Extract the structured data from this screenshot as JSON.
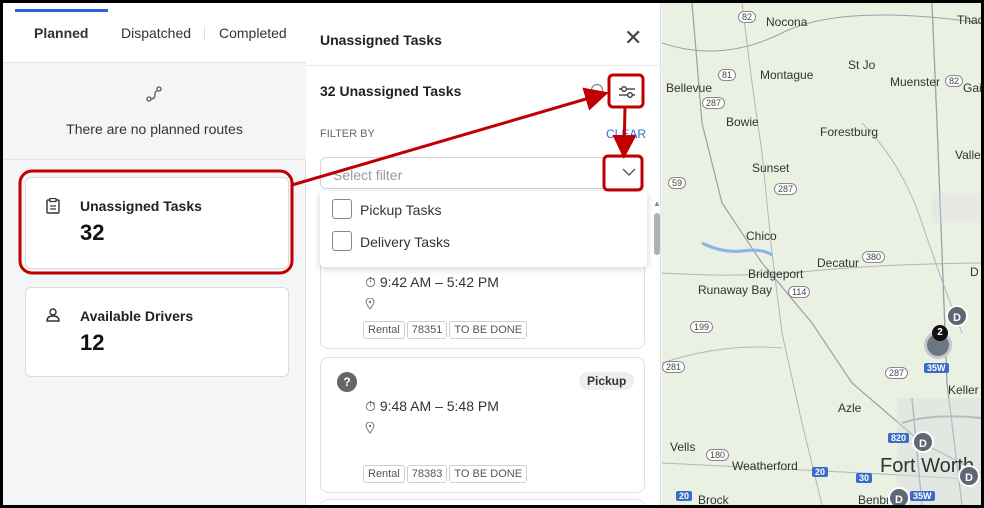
{
  "tabs": {
    "planned": "Planned",
    "dispatched": "Dispatched",
    "completed": "Completed"
  },
  "empty_state": {
    "icon": "route-icon",
    "text": "There are no planned routes"
  },
  "stats": {
    "unassigned": {
      "icon": "clipboard-icon",
      "label": "Unassigned Tasks",
      "value": "32"
    },
    "drivers": {
      "icon": "person-icon",
      "label": "Available Drivers",
      "value": "12"
    }
  },
  "panel": {
    "title": "Unassigned Tasks",
    "close_icon": "close-icon",
    "count_title": "32 Unassigned Tasks",
    "filter_by": "FILTER BY",
    "clear": "CLEAR",
    "select_placeholder": "Select filter",
    "options": [
      "Pickup Tasks",
      "Delivery Tasks"
    ]
  },
  "tasks": [
    {
      "time": "9:42 AM – 5:42 PM",
      "tags": [
        "Rental",
        "78351",
        "TO BE DONE"
      ]
    },
    {
      "badge": "?",
      "type": "Pickup",
      "time": "9:48 AM – 5:48 PM",
      "tags": [
        "Rental",
        "78383",
        "TO BE DONE"
      ]
    }
  ],
  "map": {
    "places": [
      "Nocona",
      "Thac",
      "Montague",
      "St Jo",
      "Muenster",
      "Gai",
      "Bellevue",
      "Bowie",
      "Forestburg",
      "Valley",
      "Sunset",
      "Chico",
      "Decatur",
      "Bridgeport",
      "Runaway Bay",
      "D",
      "Keller",
      "Azle",
      "Weatherford",
      "Fort Worth",
      "Brock",
      "Benbro",
      "Vells"
    ],
    "highways": [
      "82",
      "81",
      "287",
      "82",
      "287",
      "59",
      "380",
      "114",
      "199",
      "287",
      "35W",
      "820",
      "180",
      "20",
      "30",
      "35W",
      "20",
      "281"
    ],
    "pins": [
      "D",
      "D",
      "D",
      "D",
      "D"
    ],
    "cluster_count": "2"
  },
  "colors": {
    "annotation": "#c00000",
    "accent": "#2563eb"
  }
}
